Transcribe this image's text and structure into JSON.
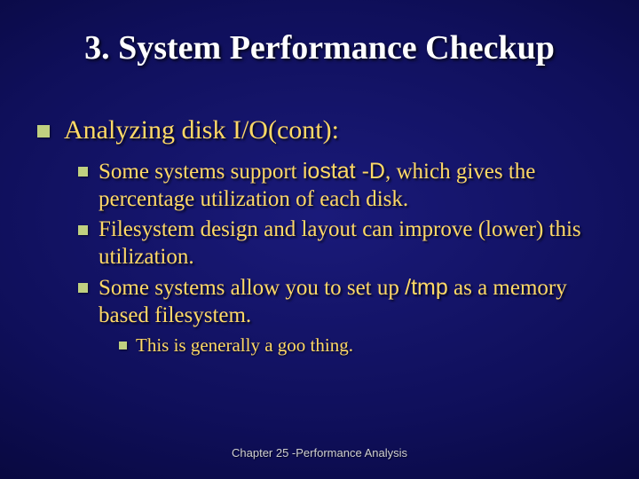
{
  "title": "3. System Performance Checkup",
  "lvl1": "Analyzing disk I/O(cont):",
  "b1a": "Some systems support ",
  "b1cmd": "iostat -D",
  "b1b": ", which gives the percentage utilization of each disk.",
  "b2": "Filesystem design and layout can improve (lower) this utilization.",
  "b3a": "Some systems allow you to set up ",
  "b3cmd": "/tmp",
  "b3b": " as a memory based filesystem.",
  "sub1": "This is generally a goo thing.",
  "footer": "Chapter 25 -Performance Analysis"
}
